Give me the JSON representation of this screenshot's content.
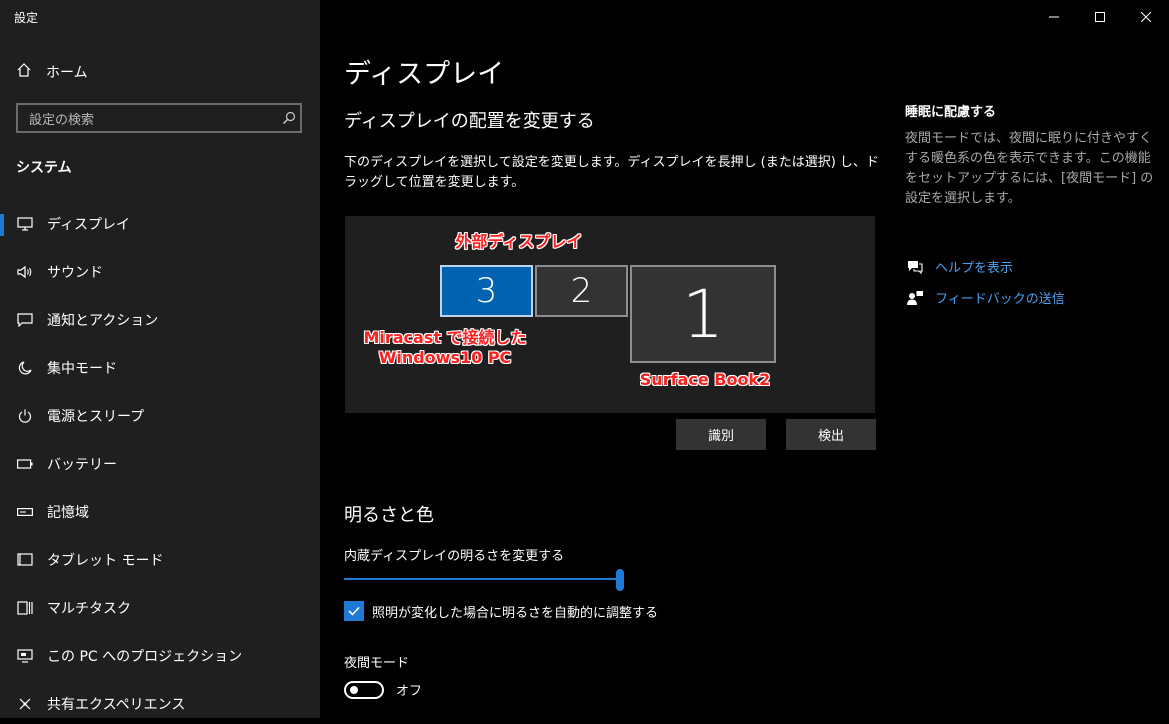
{
  "app": {
    "title": "設定"
  },
  "window_controls": {
    "minimize": "—",
    "maximize": "☐",
    "close": "✕"
  },
  "sidebar": {
    "home_label": "ホーム",
    "search_placeholder": "設定の検索",
    "section_title": "システム",
    "items": [
      {
        "label": "ディスプレイ",
        "icon": "monitor-icon",
        "active": true
      },
      {
        "label": "サウンド",
        "icon": "speaker-icon"
      },
      {
        "label": "通知とアクション",
        "icon": "notification-icon"
      },
      {
        "label": "集中モード",
        "icon": "moon-icon"
      },
      {
        "label": "電源とスリープ",
        "icon": "power-icon"
      },
      {
        "label": "バッテリー",
        "icon": "battery-icon"
      },
      {
        "label": "記憶域",
        "icon": "storage-icon"
      },
      {
        "label": "タブレット モード",
        "icon": "tablet-icon"
      },
      {
        "label": "マルチタスク",
        "icon": "multitask-icon"
      },
      {
        "label": "この PC へのプロジェクション",
        "icon": "projection-icon"
      },
      {
        "label": "共有エクスペリエンス",
        "icon": "share-icon"
      }
    ]
  },
  "main": {
    "page_title": "ディスプレイ",
    "arrange_title": "ディスプレイの配置を変更する",
    "arrange_desc": "下のディスプレイを選択して設定を変更します。ディスプレイを長押し (または選択) し、ドラッグして位置を変更します。",
    "monitors": [
      {
        "number": "3",
        "selected": true
      },
      {
        "number": "2",
        "selected": false
      },
      {
        "number": "1",
        "selected": false
      }
    ],
    "annotations": {
      "external": "外部ディスプレイ",
      "miracast_line1": "Miracast で接続した",
      "miracast_line2": "Windows10 PC",
      "surface": "Surface Book2"
    },
    "identify_button": "識別",
    "detect_button": "検出",
    "brightness_section": "明るさと色",
    "brightness_label": "内蔵ディスプレイの明るさを変更する",
    "brightness_value": 1.0,
    "auto_brightness_label": "照明が変化した場合に明るさを自動的に調整する",
    "auto_brightness_checked": true,
    "night_mode_label": "夜間モード",
    "night_mode_state": "オフ"
  },
  "right_panel": {
    "title": "睡眠に配慮する",
    "desc": "夜間モードでは、夜間に眠りに付きやすくする暖色系の色を表示できます。この機能をセットアップするには、[夜間モード] の設定を選択します。",
    "help_link": "ヘルプを表示",
    "feedback_link": "フィードバックの送信"
  },
  "colors": {
    "accent": "#1f7ad6",
    "link": "#4aa0ec",
    "annotation": "#ff2020"
  }
}
